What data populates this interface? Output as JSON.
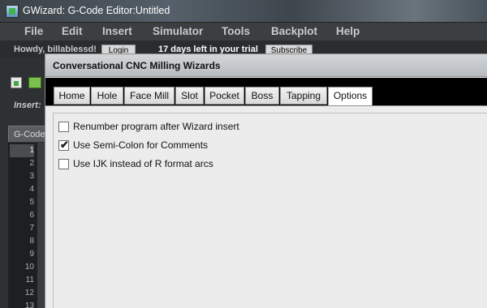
{
  "window": {
    "title": "GWizard: G-Code Editor:Untitled"
  },
  "menubar": {
    "items": [
      "File",
      "Edit",
      "Insert",
      "Simulator",
      "Tools",
      "Backplot",
      "Help"
    ]
  },
  "greeting": {
    "text": "Howdy, billablessd!",
    "login_label": "Login",
    "trial_text": "17 days left in your trial",
    "subscribe_label": "Subscribe"
  },
  "toolbar": {
    "icons": [
      "new-file-icon",
      "open-file-icon"
    ]
  },
  "insert_bar": {
    "label": "Insert:"
  },
  "editor": {
    "tab_label": "G-Code",
    "line_numbers": [
      "1",
      "2",
      "3",
      "4",
      "5",
      "6",
      "7",
      "8",
      "9",
      "10",
      "11",
      "12",
      "13"
    ]
  },
  "dialog": {
    "title": "Conversational CNC Milling Wizards",
    "tabs": [
      "Home",
      "Hole",
      "Face Mill",
      "Slot",
      "Pocket",
      "Boss",
      "Tapping",
      "Options"
    ],
    "selected_tab": "Options",
    "options": [
      {
        "label": "Renumber program after Wizard insert",
        "checked": false
      },
      {
        "label": "Use Semi-Colon for Comments",
        "checked": true
      },
      {
        "label": "Use IJK instead of R format arcs",
        "checked": false
      }
    ]
  },
  "colors": {
    "accent_dark": "#2e3133",
    "dialog_bg": "#ececec"
  }
}
